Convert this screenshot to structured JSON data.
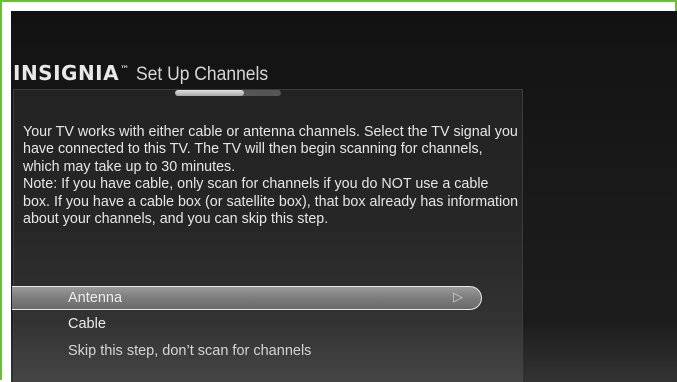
{
  "brand": {
    "logo_text": "INSIGNIA",
    "trademark": "™"
  },
  "header": {
    "title": "Set Up Channels"
  },
  "progress": {
    "fraction": 0.65
  },
  "description": {
    "paragraph1": "Your TV works with either cable or antenna channels. Select the TV signal you have connected to this TV. The TV will then begin scanning for channels, which may take up to 30 minutes.",
    "paragraph2": "Note: If you have cable, only scan for channels if you do NOT use a cable box. If you have a cable box (or satellite box), that box already has information about your channels, and you can skip this step."
  },
  "options": [
    {
      "label": "Antenna",
      "selected": true,
      "icon": "play-arrow-icon"
    },
    {
      "label": "Cable",
      "selected": false
    },
    {
      "label": "Skip this step, don’t scan for channels",
      "selected": false
    }
  ],
  "colors": {
    "frame_border": "#6abf3a",
    "background": "#151515",
    "text": "#e6e6e6"
  }
}
